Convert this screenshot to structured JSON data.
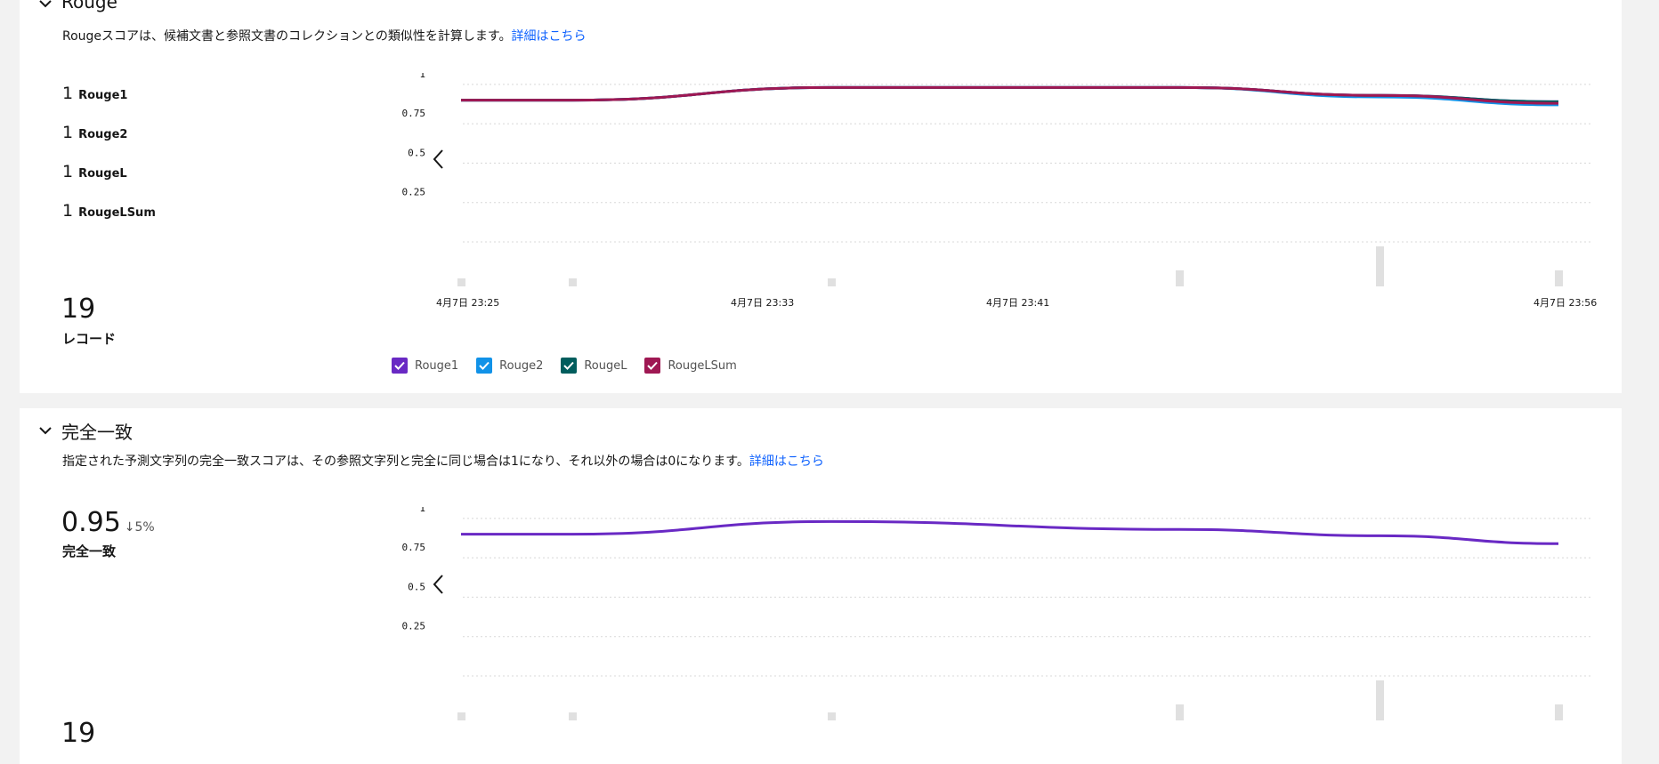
{
  "colors": {
    "rouge1": "#6929c4",
    "rouge2": "#1192e8",
    "rougeL": "#005d5d",
    "rougeLSum": "#9f1853",
    "link": "#0f62fe",
    "bars": "#e0e0e0"
  },
  "sections": [
    {
      "title": "Rouge",
      "description": "Rougeスコアは、候補文書と参照文書のコレクションとの類似性を計算します。",
      "link_label": "詳細はこちら",
      "metrics": [
        {
          "value": "1",
          "label": "Rouge1"
        },
        {
          "value": "1",
          "label": "Rouge2"
        },
        {
          "value": "1",
          "label": "RougeL"
        },
        {
          "value": "1",
          "label": "RougeLSum"
        }
      ],
      "records": {
        "value": "19",
        "label": "レコード"
      },
      "legend": [
        {
          "label": "Rouge1",
          "color_key": "rouge1",
          "checked": true
        },
        {
          "label": "Rouge2",
          "color_key": "rouge2",
          "checked": true
        },
        {
          "label": "RougeL",
          "color_key": "rougeL",
          "checked": true
        },
        {
          "label": "RougeLSum",
          "color_key": "rougeLSum",
          "checked": true
        }
      ]
    },
    {
      "title": "完全一致",
      "description": "指定された予測文字列の完全一致スコアは、その参照文字列と完全に同じ場合は1になり、それ以外の場合は0になります。",
      "link_label": "詳細はこちら",
      "metric": {
        "value": "0.95",
        "delta": "↓5%",
        "label": "完全一致"
      },
      "records": {
        "value": "19"
      }
    }
  ],
  "chart_data": [
    {
      "type": "line",
      "x": [
        "4月7日 23:25",
        "4月7日 23:29",
        "4月7日 23:37",
        "4月7日 23:47",
        "4月7日 23:52",
        "4月7日 23:56"
      ],
      "xticks": [
        "4月7日 23:25",
        "4月7日 23:33",
        "4月7日 23:41",
        "4月7日 23:56"
      ],
      "series": [
        {
          "name": "Rouge1",
          "values": [
            0.9,
            0.9,
            0.98,
            0.98,
            0.93,
            0.89
          ]
        },
        {
          "name": "Rouge2",
          "values": [
            0.9,
            0.9,
            0.98,
            0.98,
            0.92,
            0.87
          ]
        },
        {
          "name": "RougeL",
          "values": [
            0.9,
            0.9,
            0.98,
            0.98,
            0.93,
            0.89
          ]
        },
        {
          "name": "RougeLSum",
          "values": [
            0.9,
            0.9,
            0.98,
            0.98,
            0.93,
            0.88
          ]
        }
      ],
      "record_bars": [
        1,
        1,
        1,
        2,
        5,
        2
      ],
      "yticks": [
        "1",
        "0.75",
        "0.5",
        "0.25"
      ],
      "ylim": [
        0,
        1.05
      ],
      "grid": true,
      "legend": "bottom-left"
    },
    {
      "type": "line",
      "x": [
        "4月7日 23:25",
        "4月7日 23:29",
        "4月7日 23:37",
        "4月7日 23:47",
        "4月7日 23:52",
        "4月7日 23:56"
      ],
      "series": [
        {
          "name": "完全一致",
          "values": [
            0.9,
            0.9,
            0.98,
            0.93,
            0.89,
            0.84
          ]
        }
      ],
      "record_bars": [
        1,
        1,
        1,
        2,
        5,
        2
      ],
      "yticks": [
        "1",
        "0.75",
        "0.5",
        "0.25"
      ],
      "ylim": [
        0,
        1.05
      ],
      "grid": true
    }
  ]
}
